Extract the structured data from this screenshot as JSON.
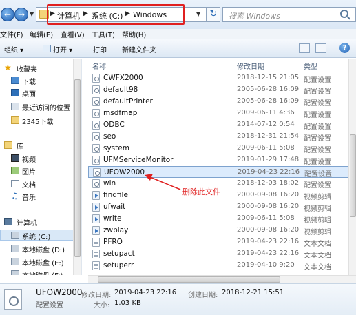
{
  "address_bar": {
    "crumbs": [
      "计算机",
      "系统 (C:)",
      "Windows"
    ],
    "search_placeholder": "搜索 Windows"
  },
  "menu": [
    "文件(F)",
    "编辑(E)",
    "查看(V)",
    "工具(T)",
    "帮助(H)"
  ],
  "toolbar": {
    "organize": "组织 ▾",
    "open": "打开 ▾",
    "print": "打印",
    "new_folder": "新建文件夹"
  },
  "nav": {
    "favorites": "收藏夹",
    "downloads": "下载",
    "desktop": "桌面",
    "recent": "最近访问的位置",
    "downloads_2345": "2345下载",
    "libraries": "库",
    "videos": "视频",
    "pictures": "图片",
    "documents": "文档",
    "music": "音乐",
    "computer": "计算机",
    "drive_c": "系统 (C:)",
    "drive_d": "本地磁盘 (D:)",
    "drive_e": "本地磁盘 (E:)",
    "drive_f": "本地磁盘 (F:)"
  },
  "columns": {
    "name": "名称",
    "date": "修改日期",
    "type": "类型"
  },
  "files": [
    {
      "name": "CWFX2000",
      "date": "2018-12-15 21:05",
      "type": "配置设置",
      "kind": "cfg"
    },
    {
      "name": "default98",
      "date": "2005-06-28 16:09",
      "type": "配置设置",
      "kind": "cfg"
    },
    {
      "name": "defaultPrinter",
      "date": "2005-06-28 16:09",
      "type": "配置设置",
      "kind": "cfg"
    },
    {
      "name": "msdfmap",
      "date": "2009-06-11 4:36",
      "type": "配置设置",
      "kind": "cfg"
    },
    {
      "name": "ODBC",
      "date": "2014-07-12 0:54",
      "type": "配置设置",
      "kind": "cfg"
    },
    {
      "name": "seo",
      "date": "2018-12-31 21:54",
      "type": "配置设置",
      "kind": "cfg"
    },
    {
      "name": "system",
      "date": "2009-06-11 5:08",
      "type": "配置设置",
      "kind": "cfg"
    },
    {
      "name": "UFMServiceMonitor",
      "date": "2019-01-29 17:48",
      "type": "配置设置",
      "kind": "cfg"
    },
    {
      "name": "UFOW2000",
      "date": "2019-04-23 22:16",
      "type": "配置设置",
      "kind": "cfg"
    },
    {
      "name": "win",
      "date": "2018-12-03 18:02",
      "type": "配置设置",
      "kind": "cfg"
    },
    {
      "name": "findfile",
      "date": "2000-09-08 16:20",
      "type": "视频剪辑",
      "kind": "media"
    },
    {
      "name": "ufwait",
      "date": "2000-09-08 16:20",
      "type": "视频剪辑",
      "kind": "media"
    },
    {
      "name": "write",
      "date": "2009-06-11 5:08",
      "type": "视频剪辑",
      "kind": "media"
    },
    {
      "name": "zwplay",
      "date": "2000-09-08 16:20",
      "type": "视频剪辑",
      "kind": "media"
    },
    {
      "name": "PFRO",
      "date": "2019-04-23 22:16",
      "type": "文本文档",
      "kind": "txt"
    },
    {
      "name": "setupact",
      "date": "2019-04-23 22:16",
      "type": "文本文档",
      "kind": "txt"
    },
    {
      "name": "setuperr",
      "date": "2019-04-10 9:20",
      "type": "文本文档",
      "kind": "txt"
    }
  ],
  "selected_file": "UFOW2000",
  "annotation": "删除此文件",
  "details": {
    "name": "UFOW2000",
    "type": "配置设置",
    "modified_label": "修改日期:",
    "modified": "2019-04-23 22:16",
    "created_label": "创建日期:",
    "created": "2018-12-21 15:51",
    "size_label": "大小:",
    "size": "1.03 KB"
  },
  "colors": {
    "highlight_red": "#e02020",
    "selected_row": "#dcebfc"
  }
}
